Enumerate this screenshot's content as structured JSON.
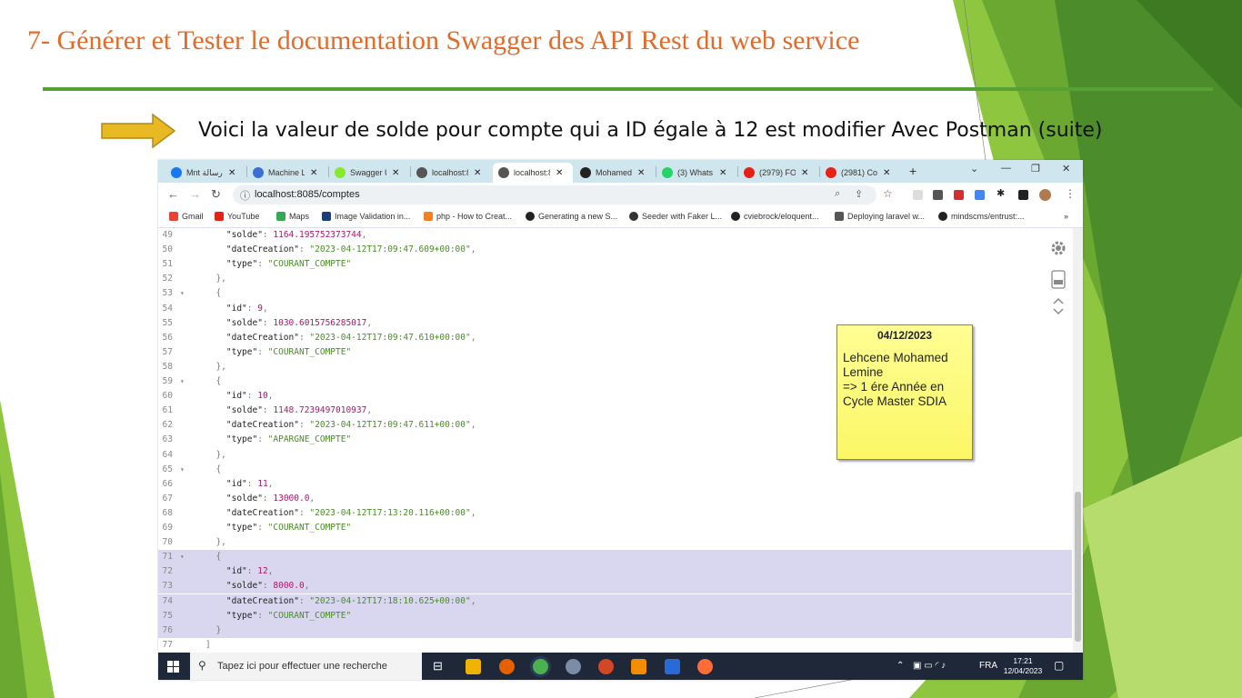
{
  "slide": {
    "title": "7- Générer et Tester le documentation Swagger des API Rest du  web service",
    "subtitle": "Voici la valeur de solde pour compte qui a ID égale à 12 est modifier Avec Postman (suite)",
    "colors": {
      "title": "#e26b2a",
      "rule": "#56a133",
      "arrow_fill": "#e8b923",
      "green_dark": "#4d8c2a",
      "green_light": "#8ec63f"
    }
  },
  "browser": {
    "tabs": [
      {
        "label": "Mnt رسالة",
        "icon": "facebook-icon"
      },
      {
        "label": "Machine L",
        "icon": "bookmark-icon"
      },
      {
        "label": "Swagger U",
        "icon": "swagger-icon"
      },
      {
        "label": "localhost:8",
        "icon": "globe-icon"
      },
      {
        "label": "localhost:8",
        "icon": "globe-icon",
        "active": true
      },
      {
        "label": "Mohamed",
        "icon": "github-icon"
      },
      {
        "label": "(3) Whats",
        "icon": "whatsapp-icon"
      },
      {
        "label": "(2979) FO",
        "icon": "youtube-icon"
      },
      {
        "label": "(2981) Co",
        "icon": "youtube-icon"
      }
    ],
    "url": "localhost:8085/comptes",
    "bookmarks": [
      {
        "label": "Gmail",
        "icon": "gmail-icon"
      },
      {
        "label": "YouTube",
        "icon": "youtube-icon"
      },
      {
        "label": "Maps",
        "icon": "maps-icon"
      },
      {
        "label": "Image Validation in...",
        "icon": "ns-icon"
      },
      {
        "label": "php - How to Creat...",
        "icon": "stackoverflow-icon"
      },
      {
        "label": "Generating a new S...",
        "icon": "github-icon"
      },
      {
        "label": "Seeder with Faker L...",
        "icon": "circle-icon"
      },
      {
        "label": "cviebrock/eloquent...",
        "icon": "github-icon"
      },
      {
        "label": "Deploying laravel w...",
        "icon": "send-icon"
      },
      {
        "label": "mindscms/entrust:...",
        "icon": "github-icon"
      }
    ],
    "more_bookmarks": "»"
  },
  "json_lines": [
    {
      "n": "49",
      "fold": "",
      "code": [
        [
          "k",
          "    \"solde\""
        ],
        [
          "p",
          ": "
        ],
        [
          "n",
          "1164.195752373744"
        ],
        [
          "p",
          ","
        ]
      ]
    },
    {
      "n": "50",
      "fold": "",
      "code": [
        [
          "k",
          "    \"dateCreation\""
        ],
        [
          "p",
          ": "
        ],
        [
          "s",
          "\"2023-04-12T17:09:47.609+00:00\""
        ],
        [
          "p",
          ","
        ]
      ]
    },
    {
      "n": "51",
      "fold": "",
      "code": [
        [
          "k",
          "    \"type\""
        ],
        [
          "p",
          ": "
        ],
        [
          "s",
          "\"COURANT_COMPTE\""
        ]
      ]
    },
    {
      "n": "52",
      "fold": "",
      "code": [
        [
          "p",
          "  },"
        ]
      ]
    },
    {
      "n": "53",
      "fold": "▾",
      "code": [
        [
          "p",
          "  {"
        ]
      ]
    },
    {
      "n": "54",
      "fold": "",
      "code": [
        [
          "k",
          "    \"id\""
        ],
        [
          "p",
          ": "
        ],
        [
          "n",
          "9"
        ],
        [
          "p",
          ","
        ]
      ]
    },
    {
      "n": "55",
      "fold": "",
      "code": [
        [
          "k",
          "    \"solde\""
        ],
        [
          "p",
          ": "
        ],
        [
          "n",
          "1030.6015756285017"
        ],
        [
          "p",
          ","
        ]
      ]
    },
    {
      "n": "56",
      "fold": "",
      "code": [
        [
          "k",
          "    \"dateCreation\""
        ],
        [
          "p",
          ": "
        ],
        [
          "s",
          "\"2023-04-12T17:09:47.610+00:00\""
        ],
        [
          "p",
          ","
        ]
      ]
    },
    {
      "n": "57",
      "fold": "",
      "code": [
        [
          "k",
          "    \"type\""
        ],
        [
          "p",
          ": "
        ],
        [
          "s",
          "\"COURANT_COMPTE\""
        ]
      ]
    },
    {
      "n": "58",
      "fold": "",
      "code": [
        [
          "p",
          "  },"
        ]
      ]
    },
    {
      "n": "59",
      "fold": "▾",
      "code": [
        [
          "p",
          "  {"
        ]
      ]
    },
    {
      "n": "60",
      "fold": "",
      "code": [
        [
          "k",
          "    \"id\""
        ],
        [
          "p",
          ": "
        ],
        [
          "n",
          "10"
        ],
        [
          "p",
          ","
        ]
      ]
    },
    {
      "n": "61",
      "fold": "",
      "code": [
        [
          "k",
          "    \"solde\""
        ],
        [
          "p",
          ": "
        ],
        [
          "n",
          "1148.7239497010937"
        ],
        [
          "p",
          ","
        ]
      ]
    },
    {
      "n": "62",
      "fold": "",
      "code": [
        [
          "k",
          "    \"dateCreation\""
        ],
        [
          "p",
          ": "
        ],
        [
          "s",
          "\"2023-04-12T17:09:47.611+00:00\""
        ],
        [
          "p",
          ","
        ]
      ]
    },
    {
      "n": "63",
      "fold": "",
      "code": [
        [
          "k",
          "    \"type\""
        ],
        [
          "p",
          ": "
        ],
        [
          "s",
          "\"APARGNE_COMPTE\""
        ]
      ]
    },
    {
      "n": "64",
      "fold": "",
      "code": [
        [
          "p",
          "  },"
        ]
      ]
    },
    {
      "n": "65",
      "fold": "▾",
      "code": [
        [
          "p",
          "  {"
        ]
      ]
    },
    {
      "n": "66",
      "fold": "",
      "code": [
        [
          "k",
          "    \"id\""
        ],
        [
          "p",
          ": "
        ],
        [
          "n",
          "11"
        ],
        [
          "p",
          ","
        ]
      ]
    },
    {
      "n": "67",
      "fold": "",
      "code": [
        [
          "k",
          "    \"solde\""
        ],
        [
          "p",
          ": "
        ],
        [
          "n",
          "13000.0"
        ],
        [
          "p",
          ","
        ]
      ]
    },
    {
      "n": "68",
      "fold": "",
      "code": [
        [
          "k",
          "    \"dateCreation\""
        ],
        [
          "p",
          ": "
        ],
        [
          "s",
          "\"2023-04-12T17:13:20.116+00:00\""
        ],
        [
          "p",
          ","
        ]
      ]
    },
    {
      "n": "69",
      "fold": "",
      "code": [
        [
          "k",
          "    \"type\""
        ],
        [
          "p",
          ": "
        ],
        [
          "s",
          "\"COURANT_COMPTE\""
        ]
      ]
    },
    {
      "n": "70",
      "fold": "",
      "code": [
        [
          "p",
          "  },"
        ]
      ]
    },
    {
      "n": "71",
      "fold": "▾",
      "hl": true,
      "code": [
        [
          "p",
          "  {"
        ]
      ]
    },
    {
      "n": "72",
      "fold": "",
      "hl": true,
      "code": [
        [
          "k",
          "    \"id\""
        ],
        [
          "p",
          ": "
        ],
        [
          "n",
          "12"
        ],
        [
          "p",
          ","
        ]
      ]
    },
    {
      "n": "73",
      "fold": "",
      "hl": true,
      "code": [
        [
          "k",
          "    \"solde\""
        ],
        [
          "p",
          ": "
        ],
        [
          "n",
          "8000.0"
        ],
        [
          "p",
          ","
        ]
      ]
    },
    {
      "n": "74",
      "fold": "",
      "hl": true,
      "code": [
        [
          "k",
          "    \"dateCreation\""
        ],
        [
          "p",
          ": "
        ],
        [
          "s",
          "\"2023-04-12T17:18:10.625+00:00\""
        ],
        [
          "p",
          ","
        ]
      ]
    },
    {
      "n": "75",
      "fold": "",
      "hl": true,
      "code": [
        [
          "k",
          "    \"type\""
        ],
        [
          "p",
          ": "
        ],
        [
          "s",
          "\"COURANT_COMPTE\""
        ]
      ]
    },
    {
      "n": "76",
      "fold": "",
      "hl": true,
      "code": [
        [
          "p",
          "  }"
        ]
      ]
    },
    {
      "n": "77",
      "fold": "",
      "code": [
        [
          "p",
          "]"
        ]
      ]
    }
  ],
  "sticky_note": {
    "date": "04/12/2023",
    "text": "Lehcene Mohamed\nLemine\n=>  1 ére Année en\nCycle Master SDIA"
  },
  "taskbar": {
    "search_placeholder": "Tapez ici pour effectuer une recherche",
    "lang": "FRA",
    "time": "17:21",
    "date": "12/04/2023"
  }
}
